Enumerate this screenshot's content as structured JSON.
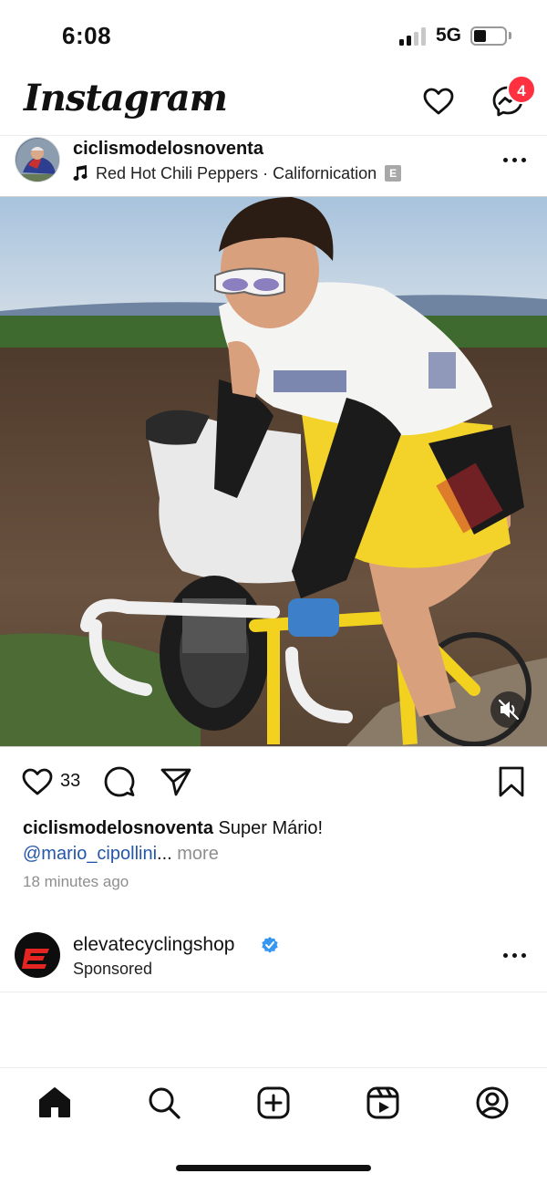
{
  "status_bar": {
    "time": "6:08",
    "network": "5G",
    "signal_bars_active": 2,
    "signal_bars_total": 4,
    "battery_level": 0.35
  },
  "header": {
    "wordmark": "Instagram",
    "messages_badge": "4",
    "icons": [
      "chevron-down-icon",
      "heart-icon",
      "messenger-icon"
    ],
    "badge_color": "#ff3040"
  },
  "post": {
    "username": "ciclismodelosnoventa",
    "audio": "Red Hot Chili Peppers · Californication",
    "explicit_badge": "E",
    "likes": "33",
    "caption_username": "ciclismodelosnoventa",
    "caption_text": "Super Mário!",
    "mention": "@mario_cipollini",
    "ellipsis": "...",
    "more_label": "more",
    "time_ago": "18 minutes ago",
    "mention_color": "#2456a8"
  },
  "sponsored": {
    "username": "elevatecyclingshop",
    "label": "Sponsored",
    "verified_color": "#3897f0",
    "logo_color": "#e52521"
  },
  "tab_bar": {
    "items": [
      "home-icon",
      "search-icon",
      "create-icon",
      "reels-icon",
      "profile-icon"
    ],
    "active": "home-icon"
  }
}
